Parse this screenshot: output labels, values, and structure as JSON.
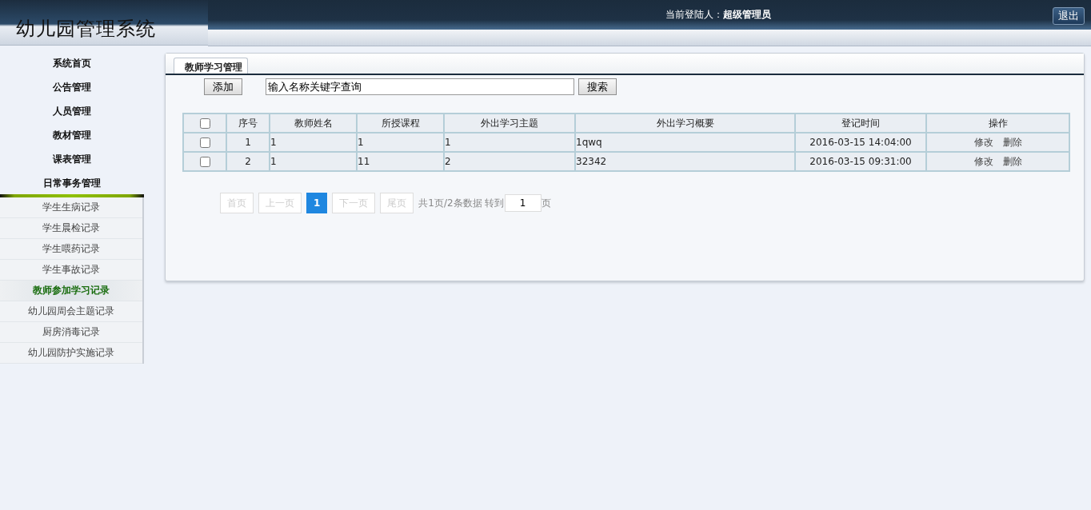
{
  "header": {
    "logo": "幼儿园管理系统",
    "user_label": "当前登陆人：",
    "user_name": "超级管理员",
    "logout": "退出"
  },
  "sidebar": {
    "items": [
      {
        "label": "系统首页",
        "selected": false
      },
      {
        "label": "公告管理",
        "selected": false
      },
      {
        "label": "人员管理",
        "selected": false
      },
      {
        "label": "教材管理",
        "selected": false
      },
      {
        "label": "课表管理",
        "selected": false
      },
      {
        "label": "日常事务管理",
        "selected": false
      }
    ],
    "subitems": [
      {
        "label": "学生生病记录",
        "selected": false
      },
      {
        "label": "学生晨检记录",
        "selected": false
      },
      {
        "label": "学生喂药记录",
        "selected": false
      },
      {
        "label": "学生事故记录",
        "selected": false
      },
      {
        "label": "教师参加学习记录",
        "selected": true
      },
      {
        "label": "幼儿园周会主题记录",
        "selected": false
      },
      {
        "label": "厨房消毒记录",
        "selected": false
      },
      {
        "label": "幼儿园防护实施记录",
        "selected": false
      }
    ]
  },
  "panel": {
    "tab": "教师学习管理",
    "add_button": "添加",
    "search": {
      "value": "输入名称关键字查询"
    },
    "search_button": "搜索"
  },
  "table": {
    "header_checked": false,
    "columns": [
      "序号",
      "教师姓名",
      "所授课程",
      "外出学习主题",
      "外出学习概要",
      "登记时间",
      "操作"
    ],
    "rows": [
      {
        "checked": false,
        "cells": [
          "1",
          "1",
          "1",
          "1",
          "1qwq",
          "2016-03-15 14:04:00"
        ],
        "actions": [
          "修改",
          "删除"
        ]
      },
      {
        "checked": false,
        "cells": [
          "2",
          "1",
          "11",
          "2",
          "32342",
          "2016-03-15 09:31:00"
        ],
        "actions": [
          "修改",
          "删除"
        ]
      }
    ]
  },
  "pagination": {
    "buttons": [
      {
        "label": "首页",
        "selected": false
      },
      {
        "label": "上一页",
        "selected": false
      },
      {
        "label": "1",
        "selected": true
      },
      {
        "label": "下一页",
        "selected": false
      },
      {
        "label": "尾页",
        "selected": false
      }
    ],
    "summary": "共1页/2条数据 转到",
    "page_input": "1",
    "page_suffix": "页"
  }
}
